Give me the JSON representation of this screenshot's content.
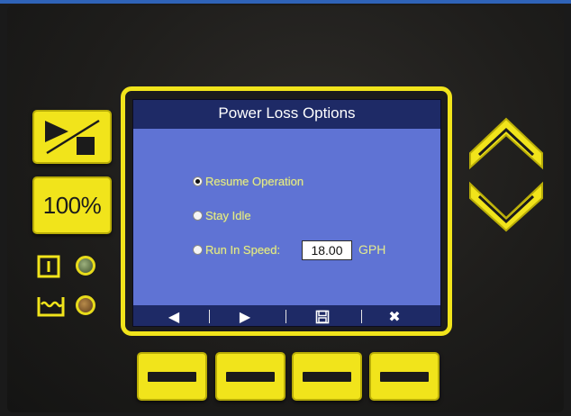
{
  "panel": {
    "left_buttons": {
      "percent_label": "100%"
    }
  },
  "screen": {
    "title": "Power Loss Options",
    "options": [
      {
        "label": "Resume Operation",
        "selected": true
      },
      {
        "label": "Stay Idle",
        "selected": false
      },
      {
        "label": "Run In Speed:",
        "selected": false
      }
    ],
    "run_in_speed": {
      "value": "18.00",
      "unit": "GPH"
    },
    "softkeys": [
      {
        "icon": "left-arrow-icon",
        "glyph": "◀"
      },
      {
        "icon": "right-arrow-icon",
        "glyph": "▶"
      },
      {
        "icon": "save-icon",
        "glyph": ""
      },
      {
        "icon": "close-icon",
        "glyph": "✖"
      }
    ]
  },
  "colors": {
    "keypad_yellow": "#f1e41b",
    "screen_blue": "#5f73d4",
    "title_bar": "#1e2a66",
    "option_text": "#e3ea8f"
  }
}
